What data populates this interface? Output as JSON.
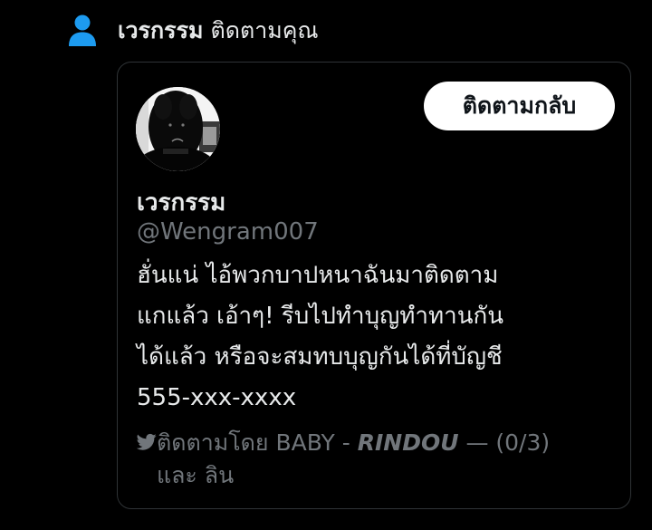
{
  "notification": {
    "icon": "person-icon",
    "icon_color": "#1d9bf0",
    "name": "เวรกรรม",
    "action": "ติดตามคุณ"
  },
  "card": {
    "avatar": "avatar-image",
    "follow_back_label": "ติดตามกลับ",
    "display_name": "เวรกรรม",
    "handle": "@Wengram007",
    "bio_lines": [
      "ฮั่นแน่ ไอ้พวกบาปหนาฉันมาติดตาม",
      "แกแล้ว เอ้าๆ! รีบไปทำบุญทำทานกัน",
      "ได้แล้ว หรือจะสมทบบุญกันได้ที่บัญชี",
      "555-xxx-xxxx"
    ],
    "followed_by": {
      "icon": "bird-icon",
      "prefix": "ติดตามโดย BABY - ",
      "emphasis": "RINDOU",
      "suffix": " — (0/3)",
      "line2": "และ ลิน"
    }
  },
  "colors": {
    "background": "#000000",
    "text_primary": "#e7e9ea",
    "text_secondary": "#71767b",
    "border": "#2f3336",
    "accent": "#1d9bf0",
    "button_bg": "#ffffff",
    "button_text": "#0f1419"
  }
}
